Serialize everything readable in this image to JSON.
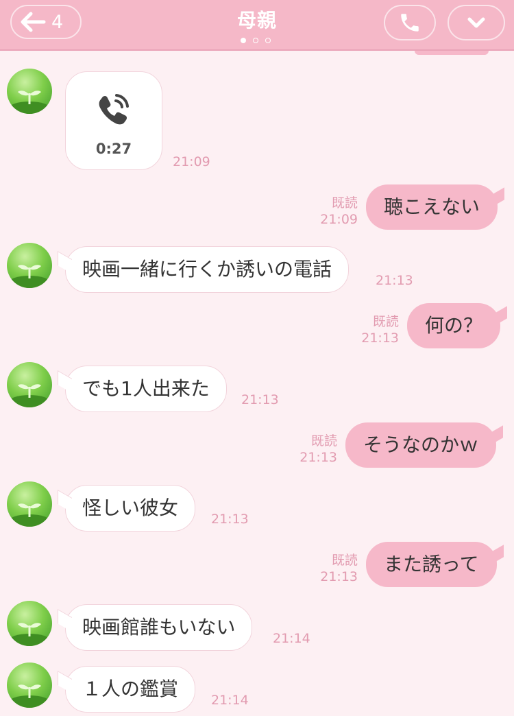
{
  "header": {
    "back_count": "4",
    "title": "母親"
  },
  "colors": {
    "header_bg": "#f5b8c8",
    "chat_bg": "#fdf0f3",
    "outgoing_bubble": "#f6b8c9",
    "incoming_bubble": "#ffffff",
    "timestamp": "#e29bb0"
  },
  "icons": {
    "back": "arrow-left-icon",
    "call": "phone-icon",
    "menu": "chevron-down-icon",
    "voice_call": "phone-call-icon",
    "avatar": "sprout-avatar"
  },
  "messages": [
    {
      "side": "left",
      "type": "call",
      "duration": "0:27",
      "time": "21:09"
    },
    {
      "side": "right",
      "text": "聴こえない",
      "read": "既読",
      "time": "21:09"
    },
    {
      "side": "left",
      "text": "映画一緒に行くか誘いの電話",
      "time": "21:13"
    },
    {
      "side": "right",
      "text": "何の？",
      "read": "既読",
      "time": "21:13"
    },
    {
      "side": "left",
      "text": "でも1人出来た",
      "time": "21:13"
    },
    {
      "side": "right",
      "text": "そうなのかｗ",
      "read": "既読",
      "time": "21:13"
    },
    {
      "side": "left",
      "text": "怪しい彼女",
      "time": "21:13"
    },
    {
      "side": "right",
      "text": "また誘って",
      "read": "既読",
      "time": "21:13"
    },
    {
      "side": "left",
      "text": "映画館誰もいない",
      "time": "21:14"
    },
    {
      "side": "left",
      "text": "１人の鑑賞",
      "time": "21:14"
    }
  ]
}
